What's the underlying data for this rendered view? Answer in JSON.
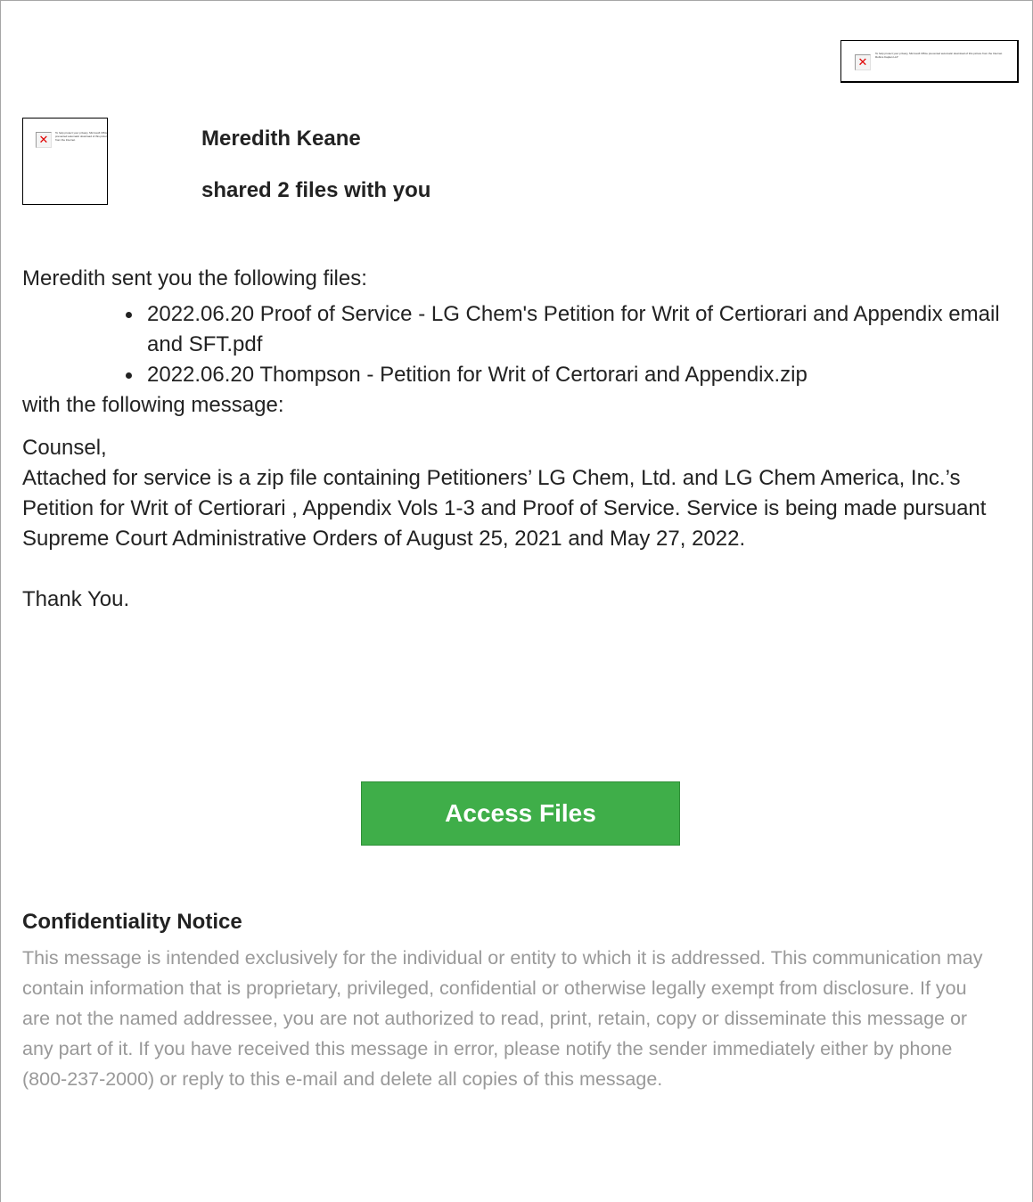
{
  "header": {
    "logo_alt": "To help protect your privacy, Microsoft Office prevented automatic download of this picture from the Internet. Robins Kaplan LLP",
    "avatar_alt": "To help protect your privacy, Microsoft Office prevented automatic download of this picture from the Internet."
  },
  "sender": {
    "name": "Meredith Keane",
    "shared_text": "shared 2 files with you"
  },
  "message": {
    "intro": "Meredith sent you the following files:",
    "files": [
      "2022.06.20 Proof of Service - LG Chem's Petition for Writ of Certiorari and Appendix email and SFT.pdf",
      "2022.06.20 Thompson - Petition for Writ of Certorari and Appendix.zip"
    ],
    "message_label": "with the following message:",
    "salutation": "Counsel,",
    "body": "Attached for service is a zip file containing Petitioners’ LG Chem, Ltd. and LG Chem America, Inc.’s Petition for Writ of Certiorari , Appendix Vols 1-3 and Proof of Service. Service is being made pursuant Supreme Court Administrative Orders of August 25, 2021 and May 27, 2022.",
    "signoff": "Thank You."
  },
  "action": {
    "access_label": "Access Files",
    "color": "#3fae49"
  },
  "notice": {
    "title": "Confidentiality Notice",
    "body": "This message is intended exclusively for the individual or entity to which it is addressed. This communication may contain information that is proprietary, privileged, confidential or otherwise legally exempt from disclosure. If you are not the named addressee, you are not authorized to read, print, retain, copy or disseminate this message or any part of it. If you have received this message in error, please notify the sender immediately either by phone (800-237-2000) or reply to this e-mail and delete all copies of this message.",
    "color": "#999999"
  }
}
